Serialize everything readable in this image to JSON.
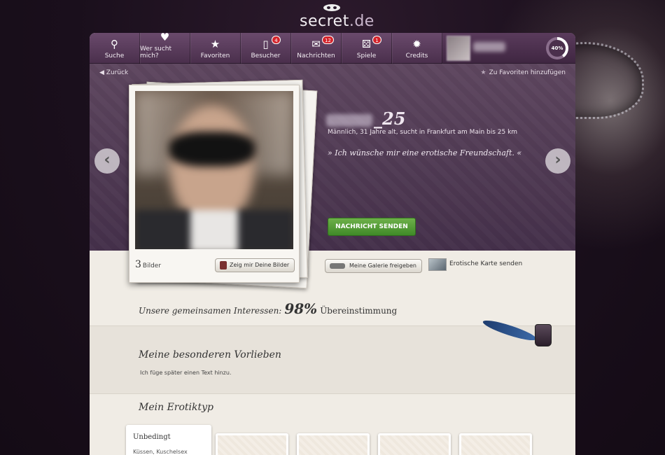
{
  "logo": {
    "name": "secret",
    "tld": ".de"
  },
  "nav": {
    "items": [
      {
        "label": "Suche",
        "icon": "search-icon",
        "badge": ""
      },
      {
        "label": "Wer sucht mich?",
        "icon": "heart-icon",
        "badge": ""
      },
      {
        "label": "Favoriten",
        "icon": "star-icon",
        "badge": ""
      },
      {
        "label": "Besucher",
        "icon": "visitors-icon",
        "badge": "4"
      },
      {
        "label": "Nachrichten",
        "icon": "envelope-icon",
        "badge": "12"
      },
      {
        "label": "Spiele",
        "icon": "dice-icon",
        "badge": "1"
      },
      {
        "label": "Credits",
        "icon": "coins-icon",
        "badge": ""
      }
    ],
    "profile_progress": "40%"
  },
  "hero": {
    "back_label": "Zurück",
    "favorite_label": "Zu Favoriten hinzufügen",
    "name_suffix": "_25",
    "subtitle": "Männlich, 31 Jahre alt, sucht in Frankfurt am Main bis 25 km",
    "quote": "» Ich wünsche mir eine erotische Freundschaft. «",
    "send_button": "NACHRICHT SENDEN"
  },
  "photos": {
    "count": "3",
    "count_label": "Bilder",
    "show_button": "Zeig mir Deine Bilder"
  },
  "actions": {
    "gallery_button": "Meine Galerie freigeben",
    "card_label": "Erotische Karte senden"
  },
  "interests": {
    "label": "Unsere gemeinsamen Interessen:",
    "percent": "98%",
    "match_label": "Übereinstimmung"
  },
  "preferences": {
    "title": "Meine besonderen Vorlieben",
    "text": "Ich füge später einen Text hinzu."
  },
  "erotiktyp": {
    "title": "Mein Erotiktyp",
    "first_card_title": "Unbedingt",
    "first_card_text": "Küssen, Kuschelsex"
  },
  "colors": {
    "nav_bg": "#5a3b5c",
    "hero_bg": "#4e3850",
    "send_button": "#4f9a33",
    "badge": "#d4242c",
    "content_bg": "#f0ece5"
  }
}
